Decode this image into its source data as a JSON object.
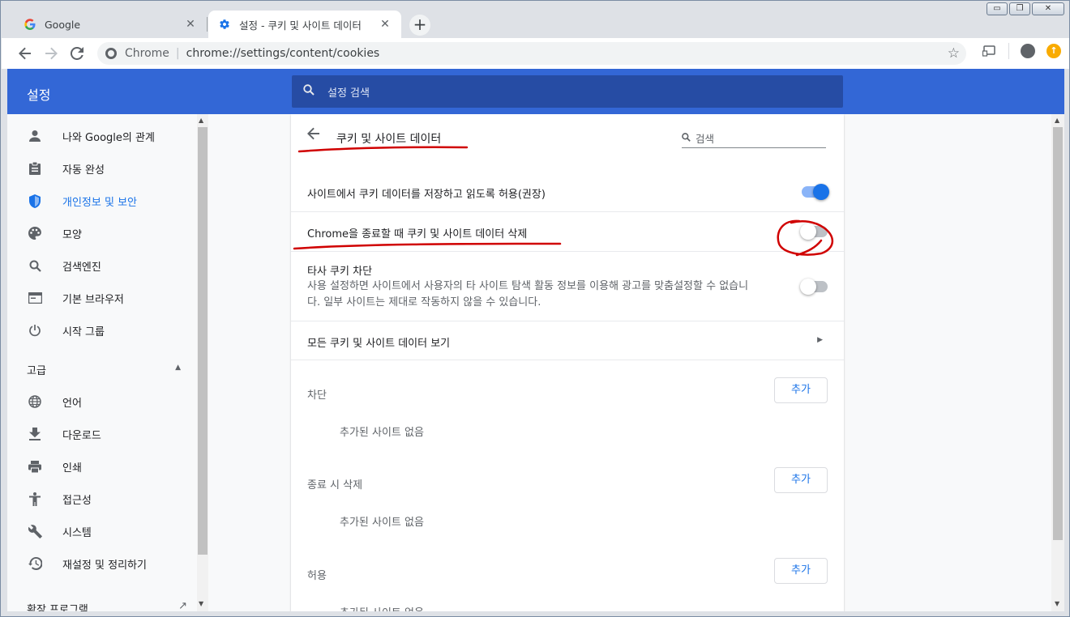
{
  "tabs": [
    {
      "title": "Google",
      "favicon": "google-g-icon",
      "active": false
    },
    {
      "title": "설정 - 쿠키 및 사이트 데이터",
      "favicon": "gear-icon",
      "active": true
    }
  ],
  "window_controls": {
    "minimize": "▭",
    "maximize": "❐",
    "close": "✕"
  },
  "omnibox": {
    "origin": "Chrome",
    "url": "chrome://settings/content/cookies"
  },
  "header": {
    "title": "설정",
    "search_placeholder": "설정 검색"
  },
  "sidebar": {
    "items": [
      {
        "label": "나와 Google의 관계",
        "icon": "person-icon",
        "selected": false
      },
      {
        "label": "자동 완성",
        "icon": "clipboard-icon",
        "selected": false
      },
      {
        "label": "개인정보 및 보안",
        "icon": "shield-icon",
        "selected": true
      },
      {
        "label": "모양",
        "icon": "palette-icon",
        "selected": false
      },
      {
        "label": "검색엔진",
        "icon": "search-icon",
        "selected": false
      },
      {
        "label": "기본 브라우저",
        "icon": "browser-window-icon",
        "selected": false
      },
      {
        "label": "시작 그룹",
        "icon": "power-icon",
        "selected": false
      }
    ],
    "advanced_label": "고급",
    "advanced_items": [
      {
        "label": "언어",
        "icon": "globe-icon"
      },
      {
        "label": "다운로드",
        "icon": "download-icon"
      },
      {
        "label": "인쇄",
        "icon": "printer-icon"
      },
      {
        "label": "접근성",
        "icon": "accessibility-icon"
      },
      {
        "label": "시스템",
        "icon": "wrench-icon"
      },
      {
        "label": "재설정 및 정리하기",
        "icon": "history-icon"
      }
    ],
    "extensions_label": "확장 프로그램"
  },
  "page": {
    "title": "쿠키 및 사이트 데이터",
    "search_placeholder": "검색",
    "settings": [
      {
        "label": "사이트에서 쿠키 데이터를 저장하고 읽도록 허용(권장)",
        "enabled": true
      },
      {
        "label": "Chrome을 종료할 때 쿠키 및 사이트 데이터 삭제",
        "enabled": false
      },
      {
        "label": "타사 쿠키 차단",
        "secondary_line1": "사용 설정하면 사이트에서 사용자의 타 사이트 탐색 활동 정보를 이용해 광고를 맞춤설정할 수 없습니",
        "secondary_line2": "다. 일부 사이트는 제대로 작동하지 않을 수 있습니다.",
        "enabled": false
      }
    ],
    "see_all": "모든 쿠키 및 사이트 데이터 보기",
    "sections": [
      {
        "label": "차단",
        "button": "추가",
        "empty": "추가된 사이트 없음"
      },
      {
        "label": "종료 시 삭제",
        "button": "추가",
        "empty": "추가된 사이트 없음"
      },
      {
        "label": "허용",
        "button": "추가",
        "empty": "추가된 사이트 없음"
      }
    ]
  },
  "colors": {
    "header_blue": "#3367d6",
    "accent": "#1a73e8",
    "annotation_red": "#d00000"
  }
}
